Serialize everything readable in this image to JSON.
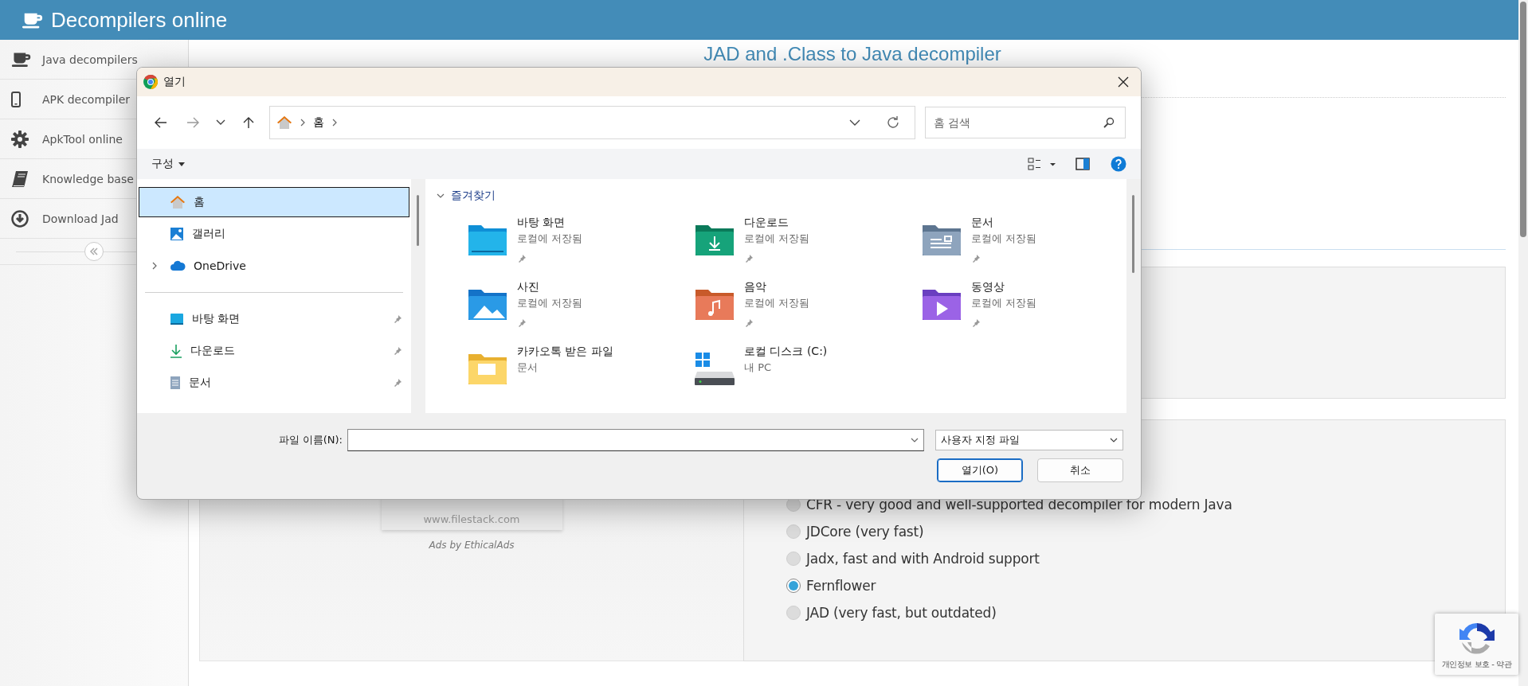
{
  "header": {
    "title": "Decompilers online"
  },
  "sidebar": {
    "items": [
      {
        "label": "Java decompilers"
      },
      {
        "label": "APK decompiler"
      },
      {
        "label": "ApkTool online"
      },
      {
        "label": "Knowledge base"
      },
      {
        "label": "Download Jad"
      }
    ]
  },
  "page": {
    "heading": "JAD and .Class to Java decompiler",
    "ad": {
      "url": "www.filestack.com",
      "credit": "Ads by EthicalAds"
    },
    "decompilers": [
      {
        "label": "CFR - very good and well-supported decompiler for modern Java",
        "selected": false
      },
      {
        "label": "JDCore (very fast)",
        "selected": false
      },
      {
        "label": "Jadx, fast and with Android support",
        "selected": false
      },
      {
        "label": "Fernflower",
        "selected": true
      },
      {
        "label": "JAD (very fast, but outdated)",
        "selected": false
      }
    ]
  },
  "recaptcha": {
    "text": "개인정보 보호 - 약관"
  },
  "dialog": {
    "title": "열기",
    "breadcrumb": [
      "홈"
    ],
    "search": {
      "placeholder": "홈 검색"
    },
    "command": "구성",
    "nav": [
      {
        "items": [
          {
            "label": "홈",
            "selected": true,
            "pinned": false,
            "expandable": false
          },
          {
            "label": "갤러리",
            "selected": false,
            "pinned": false,
            "expandable": false
          },
          {
            "label": "OneDrive",
            "selected": false,
            "pinned": false,
            "expandable": true
          }
        ]
      },
      {
        "items": [
          {
            "label": "바탕 화면",
            "selected": false,
            "pinned": true,
            "expandable": false
          },
          {
            "label": "다운로드",
            "selected": false,
            "pinned": true,
            "expandable": false
          },
          {
            "label": "문서",
            "selected": false,
            "pinned": true,
            "expandable": false
          }
        ]
      }
    ],
    "group": {
      "label": "즐겨찾기",
      "expanded": true
    },
    "items": [
      {
        "name": "바탕 화면",
        "detail": "로컬에 저장됨",
        "pinned": true
      },
      {
        "name": "다운로드",
        "detail": "로컬에 저장됨",
        "pinned": true
      },
      {
        "name": "문서",
        "detail": "로컬에 저장됨",
        "pinned": true
      },
      {
        "name": "사진",
        "detail": "로컬에 저장됨",
        "pinned": true
      },
      {
        "name": "음악",
        "detail": "로컬에 저장됨",
        "pinned": true
      },
      {
        "name": "동영상",
        "detail": "로컬에 저장됨",
        "pinned": true
      },
      {
        "name": "카카오톡 받은 파일",
        "detail": "문서",
        "pinned": false
      },
      {
        "name": "로컬 디스크 (C:)",
        "detail": "내 PC",
        "pinned": false
      }
    ],
    "filename": {
      "label": "파일 이름(N):"
    },
    "filter": "사용자 지정 파일",
    "buttons": [
      {
        "label": "열기(O)",
        "primary": true
      },
      {
        "label": "취소",
        "primary": false
      }
    ]
  }
}
